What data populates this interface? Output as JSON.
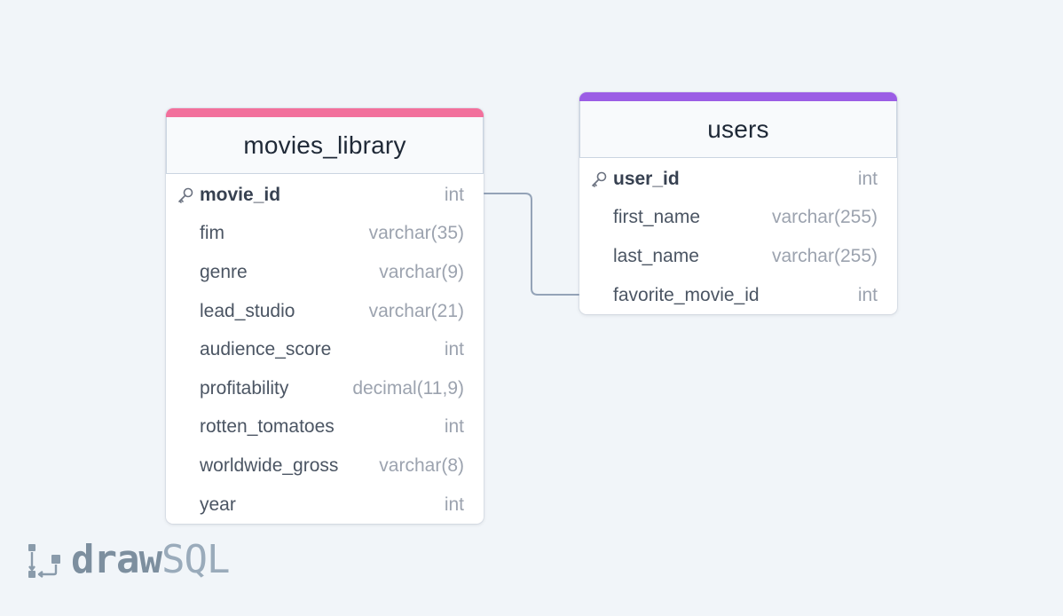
{
  "tables": {
    "movies": {
      "name": "movies_library",
      "accent_color": "#f2709c",
      "columns": [
        {
          "name": "movie_id",
          "type": "int",
          "pk": true
        },
        {
          "name": "fim",
          "type": "varchar(35)"
        },
        {
          "name": "genre",
          "type": "varchar(9)"
        },
        {
          "name": "lead_studio",
          "type": "varchar(21)"
        },
        {
          "name": "audience_score",
          "type": "int"
        },
        {
          "name": "profitability",
          "type": "decimal(11,9)"
        },
        {
          "name": "rotten_tomatoes",
          "type": "int"
        },
        {
          "name": "worldwide_gross",
          "type": "varchar(8)"
        },
        {
          "name": "year",
          "type": "int"
        }
      ]
    },
    "users": {
      "name": "users",
      "accent_color": "#9b5de5",
      "columns": [
        {
          "name": "user_id",
          "type": "int",
          "pk": true
        },
        {
          "name": "first_name",
          "type": "varchar(255)"
        },
        {
          "name": "last_name",
          "type": "varchar(255)"
        },
        {
          "name": "favorite_movie_id",
          "type": "int"
        }
      ]
    }
  },
  "relation": {
    "from": "movies_library.movie_id",
    "to": "users.favorite_movie_id",
    "color": "#94a3b8"
  },
  "logo": {
    "bold": "draw",
    "light": "SQL"
  }
}
